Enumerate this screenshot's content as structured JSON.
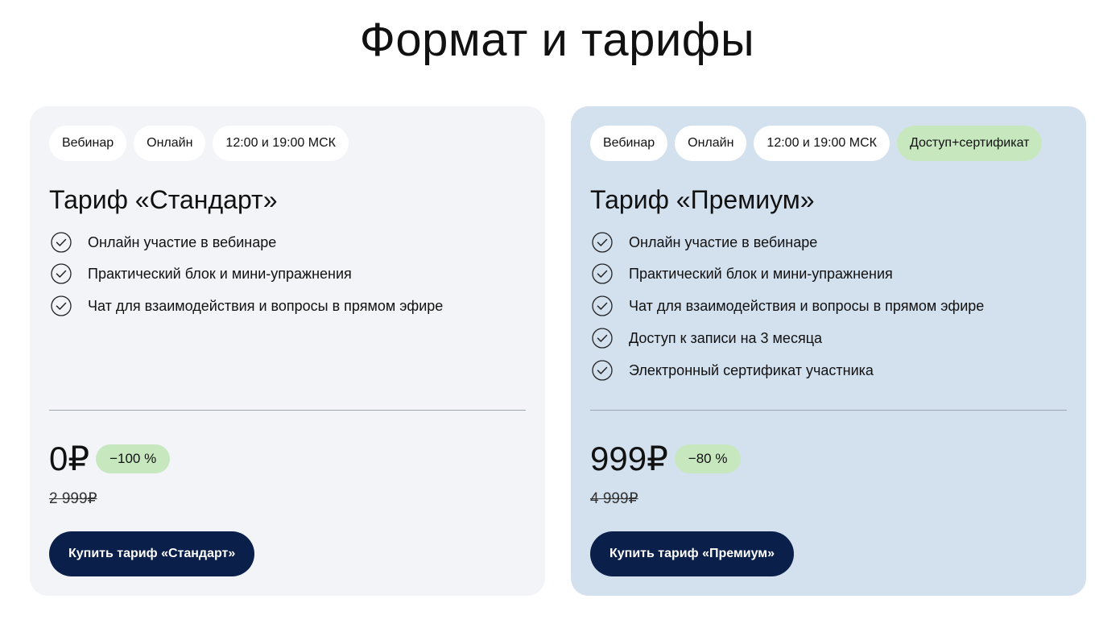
{
  "title": "Формат и тарифы",
  "icons": {
    "check": "check-circle-icon"
  },
  "colors": {
    "standard_card_bg": "#f2f4f8",
    "premium_card_bg": "#d3e0ee",
    "accent_badge": "#c7e8bf",
    "button_bg": "#0b1f4b"
  },
  "plans": [
    {
      "tags": [
        "Вебинар",
        "Онлайн",
        "12:00 и 19:00 МСК"
      ],
      "title": "Тариф «Стандарт»",
      "features": [
        "Онлайн участие в вебинаре",
        "Практический блок и мини-упражнения",
        "Чат для взаимодействия и вопросы в прямом эфире"
      ],
      "price": "0₽",
      "discount": "−100 %",
      "old_price": "2 999₽",
      "button": "Купить тариф «Стандарт»"
    },
    {
      "tags": [
        "Вебинар",
        "Онлайн",
        "12:00 и 19:00 МСК",
        "Доступ+сертификат"
      ],
      "title": "Тариф «Премиум»",
      "features": [
        "Онлайн участие в вебинаре",
        "Практический блок и мини-упражнения",
        "Чат для взаимодействия и вопросы в прямом эфире",
        "Доступ к записи на 3 месяца",
        "Электронный сертификат участника"
      ],
      "price": "999₽",
      "discount": "−80 %",
      "old_price": "4 999₽",
      "button": "Купить тариф «Премиум»"
    }
  ]
}
